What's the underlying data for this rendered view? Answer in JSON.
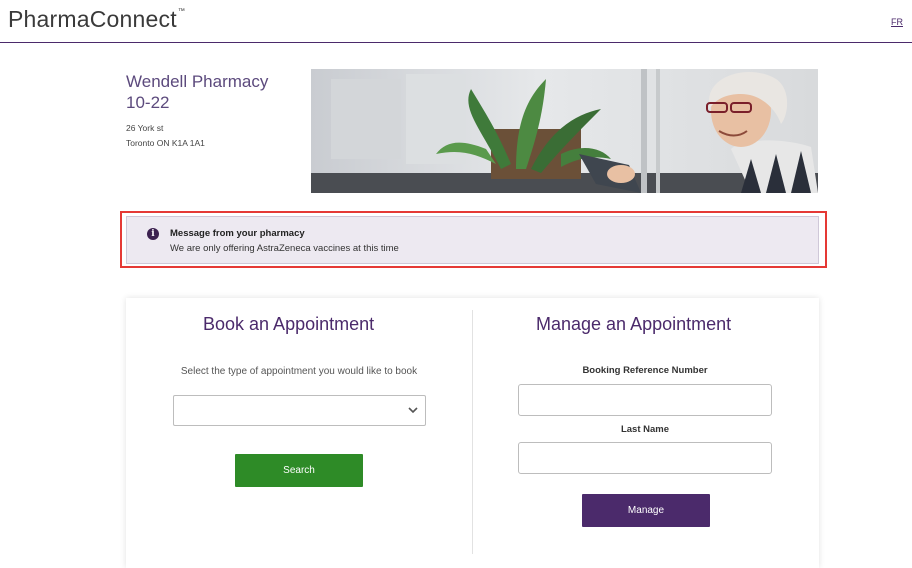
{
  "header": {
    "logo": "PharmaConnect",
    "logo_mark": "™",
    "lang_link": "FR"
  },
  "pharmacy": {
    "name": "Wendell Pharmacy",
    "code": "10-22",
    "address_line1": "26 York st",
    "address_line2": "Toronto ON  K1A 1A1"
  },
  "message": {
    "title": "Message from your pharmacy",
    "text": "We are only offering AstraZeneca vaccines at this time",
    "icon": "info-icon"
  },
  "book": {
    "title": "Book an Appointment",
    "select_label": "Select the type of appointment you would like to book",
    "select_value": "",
    "search_label": "Search"
  },
  "manage": {
    "title": "Manage an Appointment",
    "ref_label": "Booking Reference Number",
    "ref_value": "",
    "lastname_label": "Last Name",
    "lastname_value": "",
    "manage_label": "Manage"
  },
  "colors": {
    "brand_purple": "#4b2a6b",
    "search_green": "#2e8b27",
    "highlight_red": "#e53935",
    "message_bg": "#ede9f1"
  }
}
